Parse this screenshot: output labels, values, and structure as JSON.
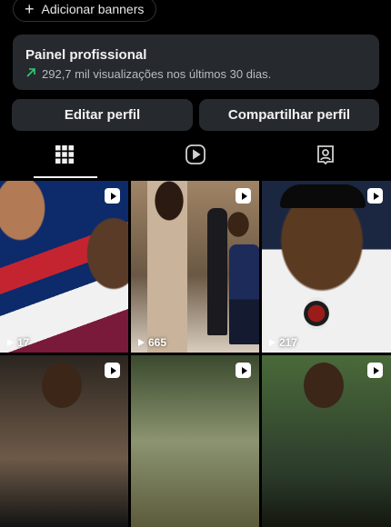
{
  "banner_chip": {
    "icon": "plus-icon",
    "label": "Adicionar banners"
  },
  "pro_panel": {
    "title": "Painel profissional",
    "stat_icon": "trending-up-icon",
    "stat_text": "292,7 mil visualizações nos últimos 30 dias."
  },
  "buttons": {
    "edit": "Editar perfil",
    "share": "Compartilhar perfil"
  },
  "tabs": [
    {
      "name": "grid",
      "icon": "grid-icon",
      "active": true
    },
    {
      "name": "reels",
      "icon": "reels-icon",
      "active": false
    },
    {
      "name": "tagged",
      "icon": "tagged-person-icon",
      "active": false
    }
  ],
  "posts": [
    {
      "views": "17",
      "icon": "reel-icon"
    },
    {
      "views": "665",
      "icon": "reel-icon"
    },
    {
      "views": "217",
      "icon": "reel-icon"
    },
    {
      "views": "",
      "icon": "reel-icon"
    },
    {
      "views": "",
      "icon": "reel-icon"
    },
    {
      "views": "",
      "icon": "reel-icon"
    }
  ],
  "colors": {
    "background": "#000000",
    "panel": "#262a2e",
    "accent_green": "#2ecc71"
  }
}
